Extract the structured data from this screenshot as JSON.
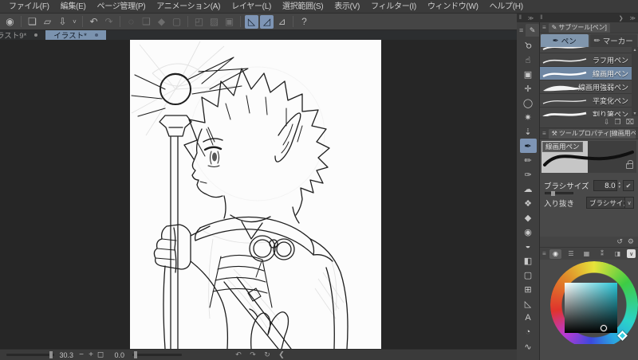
{
  "colors": {
    "accent_blue": "#7e95b5",
    "selected_row_blue": "#6f87a3",
    "panel_bg": "#494949",
    "canvas_bg": "#262626",
    "canvas_paper": "#fcfcfc",
    "selected_hue": "#2bc6d8"
  },
  "menu_bar": {
    "items": [
      "ファイル(F)",
      "編集(E)",
      "ページ管理(P)",
      "アニメーション(A)",
      "レイヤー(L)",
      "選択範囲(S)",
      "表示(V)",
      "フィルター(I)",
      "ウィンドウ(W)",
      "ヘルプ(H)"
    ]
  },
  "toolbar": {
    "icons": [
      "◉",
      "❏",
      "▱",
      "⇩",
      "˅",
      "↶",
      "↷",
      "◌",
      "❑",
      "◆",
      "▢",
      "◰",
      "▨",
      "▣",
      "◺",
      "◿",
      "⊿",
      "?"
    ]
  },
  "document_tabs": {
    "tab1": {
      "label": "ラスト9*",
      "dot": ""
    },
    "tab2": {
      "label": "イラスト*",
      "dot": ""
    }
  },
  "panel_chrome": {
    "grip": "‖",
    "expand": "❯",
    "collapse": "≫"
  },
  "tool_strip": {
    "menu_icon": "≡",
    "pen_tab_icon": "✎",
    "tools": [
      "⚲",
      "☝",
      "▣",
      "✛",
      "◯",
      "✷",
      "⇣",
      "✒",
      "✏",
      "✑",
      "☁",
      "❖",
      "◆",
      "◉",
      "◒",
      "◧",
      "▢",
      "⊞",
      "◺",
      "A",
      "◔",
      "∿"
    ]
  },
  "subtool": {
    "menu_icon": "≡",
    "title": "サブツール[ペン]",
    "title_icon": "✎",
    "tabs": {
      "pen": {
        "label": "ペン",
        "icon": "✒"
      },
      "marker": {
        "label": "マーカー",
        "icon": "✏"
      }
    },
    "brushes": [
      {
        "label": ""
      },
      {
        "label": "ラフ用ペン"
      },
      {
        "label": "線画用ペン"
      },
      {
        "label": "線画用強弱ペン"
      },
      {
        "label": "平変化ペン"
      },
      {
        "label": "割り箸ペン"
      }
    ],
    "scroll_up": "▴",
    "scroll_down": "▾",
    "footer_icons": {
      "import": "⇩",
      "duplicate": "❐",
      "delete": "⌧"
    }
  },
  "tool_property": {
    "menu_icon": "≡",
    "title": "ツールプロパティ[線画用ペン]",
    "title_icon": "⚒",
    "preview_label": "線画用ペン",
    "brush_size_label": "ブラシサイズ",
    "brush_size_value": "8.0",
    "spin_up": "▴",
    "spin_down": "▾",
    "dynamics_icon": "✔",
    "inout_label": "入り抜き",
    "inout_value": "ブラシサイズ ブラ",
    "dropdown_chevron": "∨",
    "footer": {
      "reset_icon": "↺",
      "settings_icon": "⚙"
    }
  },
  "color_wheel": {
    "menu_icon": "≡",
    "tabs": [
      "◉",
      "☰",
      "▦",
      "⁑",
      "◨"
    ],
    "chevron": "∨"
  },
  "status_bar": {
    "zoom_value": "30.3",
    "zoom_out": "−",
    "zoom_in": "+",
    "fit_icon": "◻",
    "rotation_value": "0.0",
    "icons": [
      "↶",
      "↷",
      "↻",
      "❮"
    ]
  }
}
